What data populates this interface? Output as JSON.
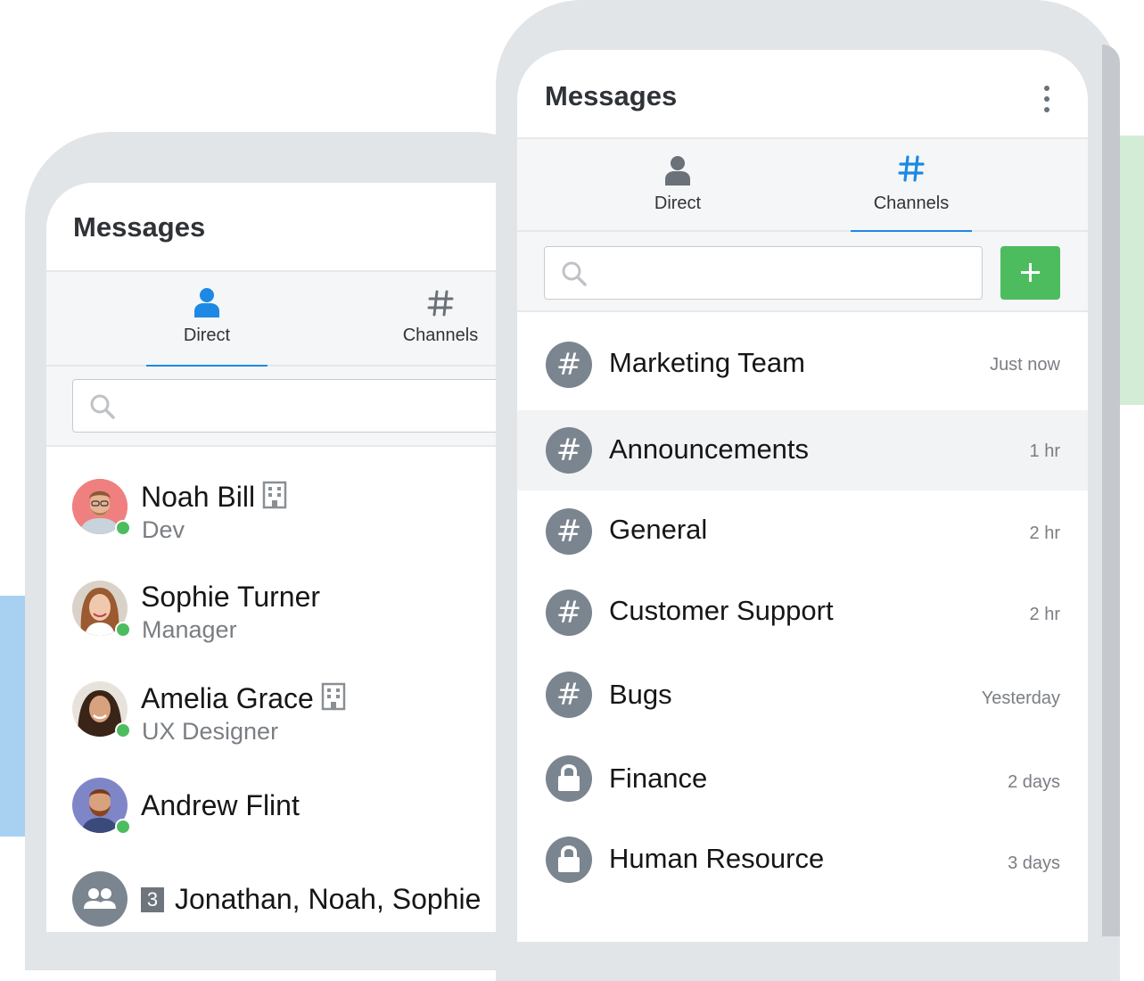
{
  "colors": {
    "accent": "#1d89e4",
    "online": "#4dbc5f",
    "add_button": "#4dbc5f",
    "icon_grey": "#7b858f",
    "frame": "#e1e5e8"
  },
  "left_app": {
    "title": "Messages",
    "tabs": [
      {
        "label": "Direct",
        "icon": "person-icon",
        "active": true
      },
      {
        "label": "Channels",
        "icon": "hash-icon",
        "active": false
      }
    ],
    "search": {
      "placeholder": "",
      "value": ""
    },
    "contacts": [
      {
        "name": "Noah Bill",
        "role": "Dev",
        "online": true,
        "badge_icon": "building-icon"
      },
      {
        "name": "Sophie Turner",
        "role": "Manager",
        "online": true
      },
      {
        "name": "Amelia Grace",
        "role": "UX Designer",
        "online": true,
        "badge_icon": "building-icon"
      },
      {
        "name": "Andrew Flint",
        "role": "",
        "online": true
      },
      {
        "name": "Jonathan, Noah, Sophie",
        "count": "3",
        "icon": "group-icon"
      }
    ]
  },
  "right_app": {
    "title": "Messages",
    "menu_icon": "kebab-menu-icon",
    "tabs": [
      {
        "label": "Direct",
        "icon": "person-icon",
        "active": false
      },
      {
        "label": "Channels",
        "icon": "hash-icon",
        "active": true
      }
    ],
    "search": {
      "placeholder": "",
      "value": ""
    },
    "add_icon": "plus-icon",
    "channels": [
      {
        "name": "Marketing Team",
        "time": "Just now",
        "icon": "hash-icon"
      },
      {
        "name": "Announcements",
        "time": "1 hr",
        "icon": "hash-icon",
        "highlighted": true
      },
      {
        "name": "General",
        "time": "2 hr",
        "icon": "hash-icon"
      },
      {
        "name": "Customer Support",
        "time": "2 hr",
        "icon": "hash-icon"
      },
      {
        "name": "Bugs",
        "time": "Yesterday",
        "icon": "hash-icon"
      },
      {
        "name": "Finance",
        "time": "2 days",
        "icon": "lock-icon"
      },
      {
        "name": "Human Resource",
        "time": "3 days",
        "icon": "lock-icon"
      }
    ]
  }
}
